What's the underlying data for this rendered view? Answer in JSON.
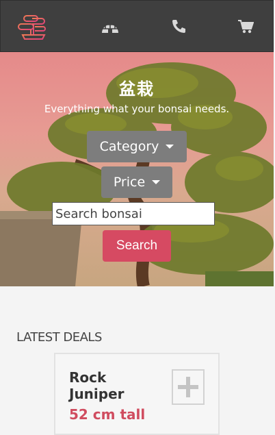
{
  "nav": {
    "icons": [
      "bonsai-logo-icon",
      "igloo-icon",
      "phone-icon",
      "cart-icon"
    ]
  },
  "hero": {
    "title": "盆栽",
    "subtitle": "Everything what your bonsai needs."
  },
  "filters": {
    "category_label": "Category",
    "price_label": "Price"
  },
  "search": {
    "placeholder": "Search bonsai",
    "value": "",
    "button_label": "Search"
  },
  "deals": {
    "section_title": "LATEST DEALS",
    "items": [
      {
        "name": "Rock Juniper",
        "size": "52 cm tall"
      }
    ]
  },
  "colors": {
    "topbar": "#3f3f3f",
    "accent": "#d64a62",
    "dropdown": "#7d7d7d",
    "price_text": "#d04c5f"
  }
}
